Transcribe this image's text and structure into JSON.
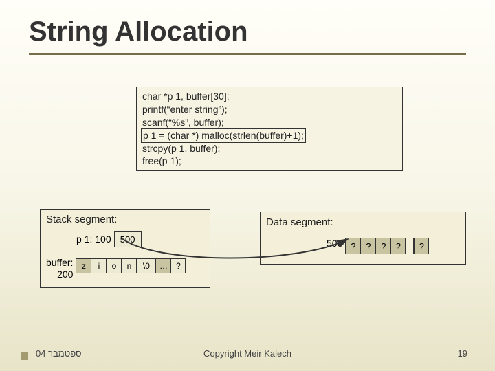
{
  "title": "String Allocation",
  "code": {
    "l1": "char *p 1, buffer[30];",
    "l2": "printf(“enter string”);",
    "l3": "scanf(“%s”, buffer);",
    "l4": "p 1 = (char *) malloc(strlen(buffer)+1);",
    "l5": "strcpy(p 1, buffer);",
    "l6": "free(p 1);"
  },
  "stack": {
    "label": "Stack segment:",
    "p1_label": "p 1: 100",
    "p1_value": "500",
    "buffer_label_top": "buffer:",
    "buffer_label_bottom": "200",
    "buffer_cells": [
      "z",
      "i",
      "o",
      "n",
      "\\0",
      "…",
      "?"
    ]
  },
  "data_seg": {
    "label": "Data segment:",
    "addr": "500",
    "cells": [
      "?",
      "?",
      "?",
      "?",
      "?"
    ]
  },
  "footer": {
    "left": "ספטמבר 04",
    "center": "Copyright Meir Kalech",
    "right": "19"
  }
}
